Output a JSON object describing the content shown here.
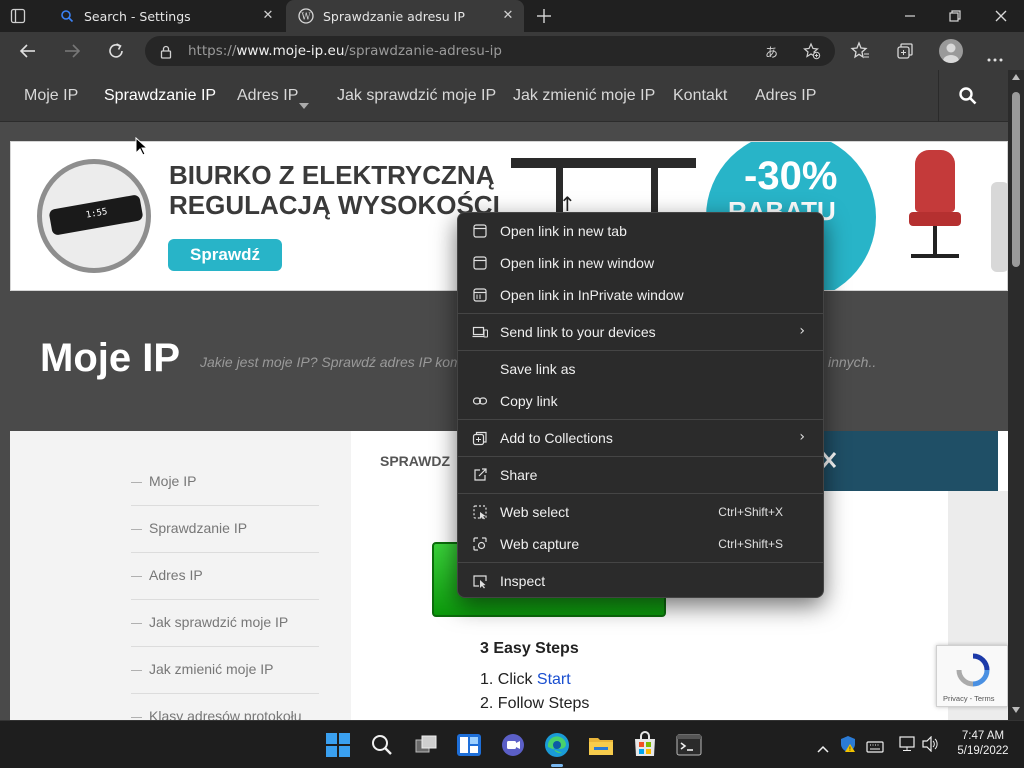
{
  "browser": {
    "tabs": [
      {
        "title": "Search - Settings",
        "active": false
      },
      {
        "title": "Sprawdzanie adresu IP",
        "active": true
      }
    ],
    "url": {
      "scheme": "https://",
      "domain": "www.moje-ip.eu",
      "path": "/sprawdzanie-adresu-ip"
    }
  },
  "site": {
    "nav": [
      "Moje IP",
      "Sprawdzanie IP",
      "Adres IP",
      "Jak sprawdzić moje IP",
      "Jak zmienić moje IP",
      "Kontakt",
      "Adres IP"
    ],
    "banner": {
      "headline_line1": "BIURKO Z ELEKTRYCZNĄ",
      "headline_line2": "REGULACJĄ WYSOKOŚCI",
      "button": "Sprawdź",
      "discount": "-30%",
      "discount_sub": "RABATU",
      "display_value": "1:55"
    },
    "hero_title": "Moje IP",
    "hero_sub_left": "Jakie jest moje IP? Sprawdź adres IP kom",
    "hero_sub_right": "innych..",
    "sidebar": [
      "Moje IP",
      "Sprawdzanie IP",
      "Adres IP",
      "Jak sprawdzić moje IP",
      "Jak zmienić moje IP",
      "Klasy adresów protokołu"
    ],
    "main_tab": "SPRAWDZ",
    "steps_title": "3 Easy Steps",
    "step1_prefix": "1. Click ",
    "step1_link": "Start",
    "step2": "2. Follow Steps",
    "recaptcha": "Privacy - Terms"
  },
  "context_menu": {
    "items": [
      {
        "label": "Open link in new tab",
        "icon": "new-tab-icon"
      },
      {
        "label": "Open link in new window",
        "icon": "new-window-icon"
      },
      {
        "label": "Open link in InPrivate window",
        "icon": "inprivate-icon"
      },
      {
        "label": "Send link to your devices",
        "icon": "devices-icon",
        "submenu": true
      },
      {
        "label": "Save link as",
        "icon": ""
      },
      {
        "label": "Copy link",
        "icon": "link-icon"
      },
      {
        "label": "Add to Collections",
        "icon": "collections-icon",
        "submenu": true
      },
      {
        "label": "Share",
        "icon": "share-icon"
      },
      {
        "label": "Web select",
        "icon": "web-select-icon",
        "shortcut": "Ctrl+Shift+X"
      },
      {
        "label": "Web capture",
        "icon": "web-capture-icon",
        "shortcut": "Ctrl+Shift+S"
      },
      {
        "label": "Inspect",
        "icon": "inspect-icon"
      }
    ]
  },
  "taskbar": {
    "time": "7:47 AM",
    "date": "5/19/2022"
  },
  "colors": {
    "frame": "#202020",
    "toolbar": "#3a3a3a",
    "menu_bg": "#2b2b2b",
    "accent_blue": "#1f4f66",
    "start_green": "#1fb51f",
    "banner_teal": "#28b4c8"
  }
}
